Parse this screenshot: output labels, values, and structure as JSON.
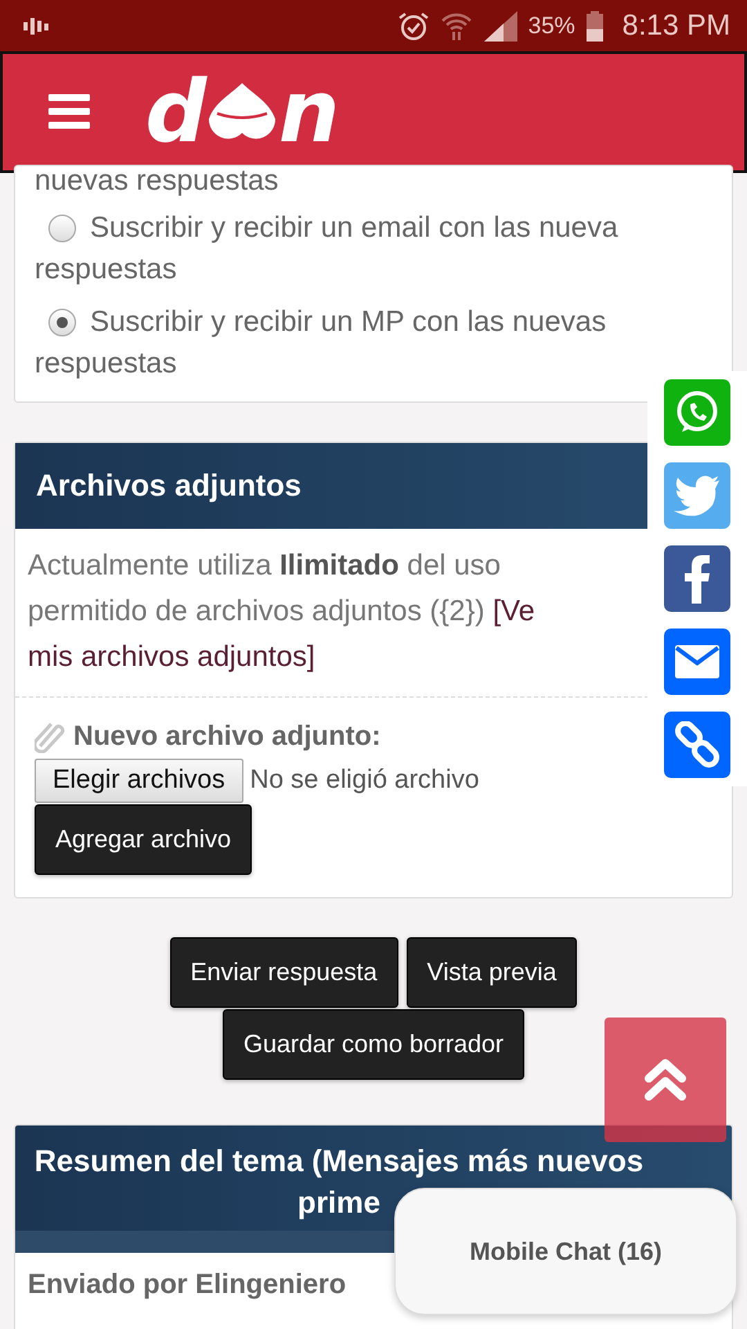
{
  "status_bar": {
    "battery": "35%",
    "time": "8:13 PM"
  },
  "header": {
    "logo_left": "d",
    "logo_right": "n"
  },
  "subscription": {
    "cut_line": "nuevas respuestas",
    "options": [
      {
        "label": "Suscribir y recibir un email con las nueva",
        "continuation": "respuestas",
        "selected": false
      },
      {
        "label": "Suscribir y recibir un MP con las nuevas",
        "continuation": "respuestas",
        "selected": true
      }
    ]
  },
  "attachments": {
    "title": "Archivos adjuntos",
    "usage": "Actualmente utiliza **Ilimitado** del uso permitido de archivos adjuntos ({2})",
    "link_start": "[Ve",
    "link_rest": "mis archivos adjuntos]",
    "new_label": "Nuevo archivo adjunto:",
    "choose_button": "Elegir archivos",
    "no_file": "No se eligió archivo",
    "add_button": "Agregar archivo"
  },
  "actions": [
    "Enviar respuesta",
    "Vista previa",
    "Guardar como borrador"
  ],
  "summary": {
    "title": "Resumen del tema (Mensajes más nuevos prime",
    "posted_by": "Enviado por Elingeniero"
  },
  "share": [
    {
      "kind": "whatsapp"
    },
    {
      "kind": "twitter"
    },
    {
      "kind": "facebook"
    },
    {
      "kind": "email"
    },
    {
      "kind": "link"
    }
  ],
  "chat": {
    "label": "Mobile Chat (16)"
  }
}
